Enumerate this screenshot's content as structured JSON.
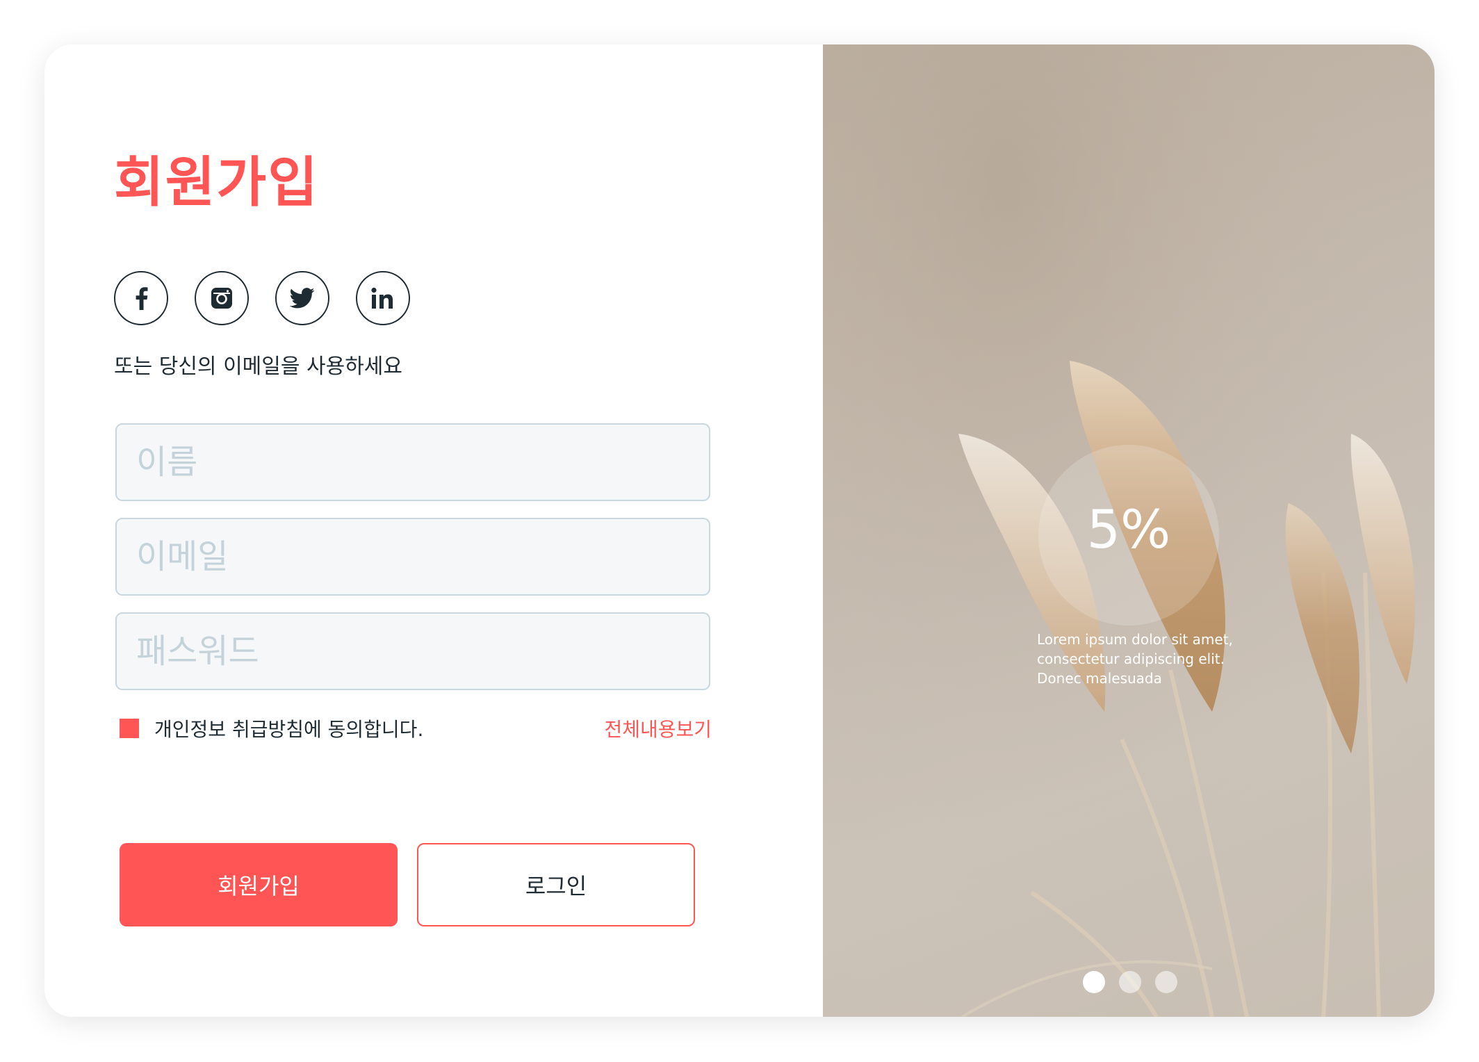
{
  "signup": {
    "title": "회원가입",
    "social": [
      {
        "icon": "facebook-icon"
      },
      {
        "icon": "instagram-icon"
      },
      {
        "icon": "twitter-icon"
      },
      {
        "icon": "linkedin-icon"
      }
    ],
    "alt_text": "또는 당신의 이메일을 사용하세요",
    "fields": {
      "name_placeholder": "이름",
      "email_placeholder": "이메일",
      "password_placeholder": "패스워드"
    },
    "agreement": {
      "checked": true,
      "label": "개인정보 취급방침에 동의합니다.",
      "view_all": "전체내용보기"
    },
    "buttons": {
      "signup": "회원가입",
      "login": "로그인"
    }
  },
  "slider": {
    "percent": "5%",
    "caption": "Lorem ipsum dolor sit amet, consectetur adipiscing elit. Donec malesuada",
    "dots_total": 3,
    "active_dot": 1
  },
  "colors": {
    "accent": "#ff5555",
    "text": "#1f2b33",
    "input_bg": "#f5f7f9",
    "input_border": "#c9d7e0"
  }
}
